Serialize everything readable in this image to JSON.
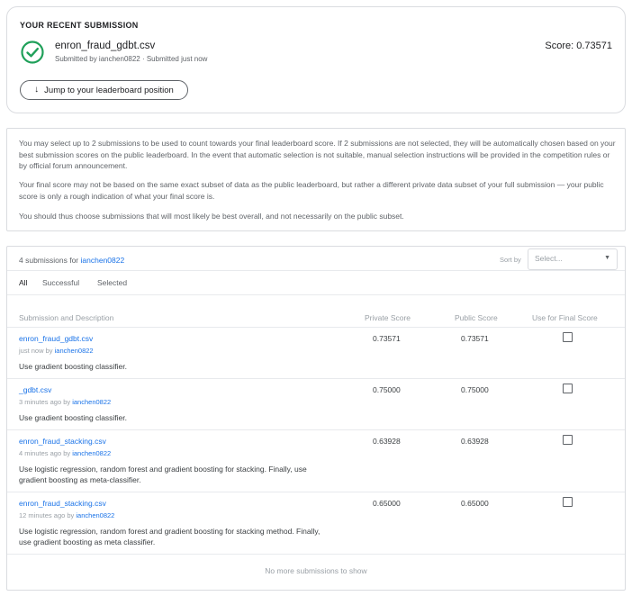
{
  "recent": {
    "heading": "YOUR RECENT SUBMISSION",
    "filename": "enron_fraud_gdbt.csv",
    "meta": "Submitted by ianchen0822 · Submitted just now",
    "score": "Score: 0.73571",
    "jump_label": "Jump to your leaderboard position",
    "status_color": "#20a05a"
  },
  "info": {
    "p1": "You may select up to 2 submissions to be used to count towards your final leaderboard score. If 2 submissions are not selected, they will be automatically chosen based on your best submission scores on the public leaderboard. In the event that automatic selection is not suitable, manual selection instructions will be provided in the competition rules or by official forum announcement.",
    "p2": "Your final score may not be based on the same exact subset of data as the public leaderboard, but rather a different private data subset of your full submission — your public score is only a rough indication of what your final score is.",
    "p3": "You should thus choose submissions that will most likely be best overall, and not necessarily on the public subset."
  },
  "submissions": {
    "count_prefix": "4 submissions for",
    "user": "ianchen0822",
    "sort_label": "Sort by",
    "sort_placeholder": "Select...",
    "tabs": [
      "All",
      "Successful",
      "Selected"
    ],
    "columns": [
      "Submission and Description",
      "Private Score",
      "Public Score",
      "Use for Final Score"
    ],
    "rows": [
      {
        "name": "enron_fraud_gdbt.csv",
        "time": "just now by",
        "user": "ianchen0822",
        "desc": "Use gradient boosting classifier.",
        "private": "0.73571",
        "public": "0.73571"
      },
      {
        "name": "_gdbt.csv",
        "time": "3 minutes ago by",
        "user": "ianchen0822",
        "desc": "Use gradient boosting classifier.",
        "private": "0.75000",
        "public": "0.75000"
      },
      {
        "name": "enron_fraud_stacking.csv",
        "time": "4 minutes ago by",
        "user": "ianchen0822",
        "desc": "Use logistic regression, random forest and gradient boosting for stacking. Finally, use gradient boosting as meta-classifier.",
        "private": "0.63928",
        "public": "0.63928"
      },
      {
        "name": "enron_fraud_stacking.csv",
        "time": "12 minutes ago by",
        "user": "ianchen0822",
        "desc": "Use logistic regression, random forest and gradient boosting for stacking method. Finally, use gradient boosting as meta classifier.",
        "private": "0.65000",
        "public": "0.65000"
      }
    ],
    "footer": "No more submissions to show"
  }
}
